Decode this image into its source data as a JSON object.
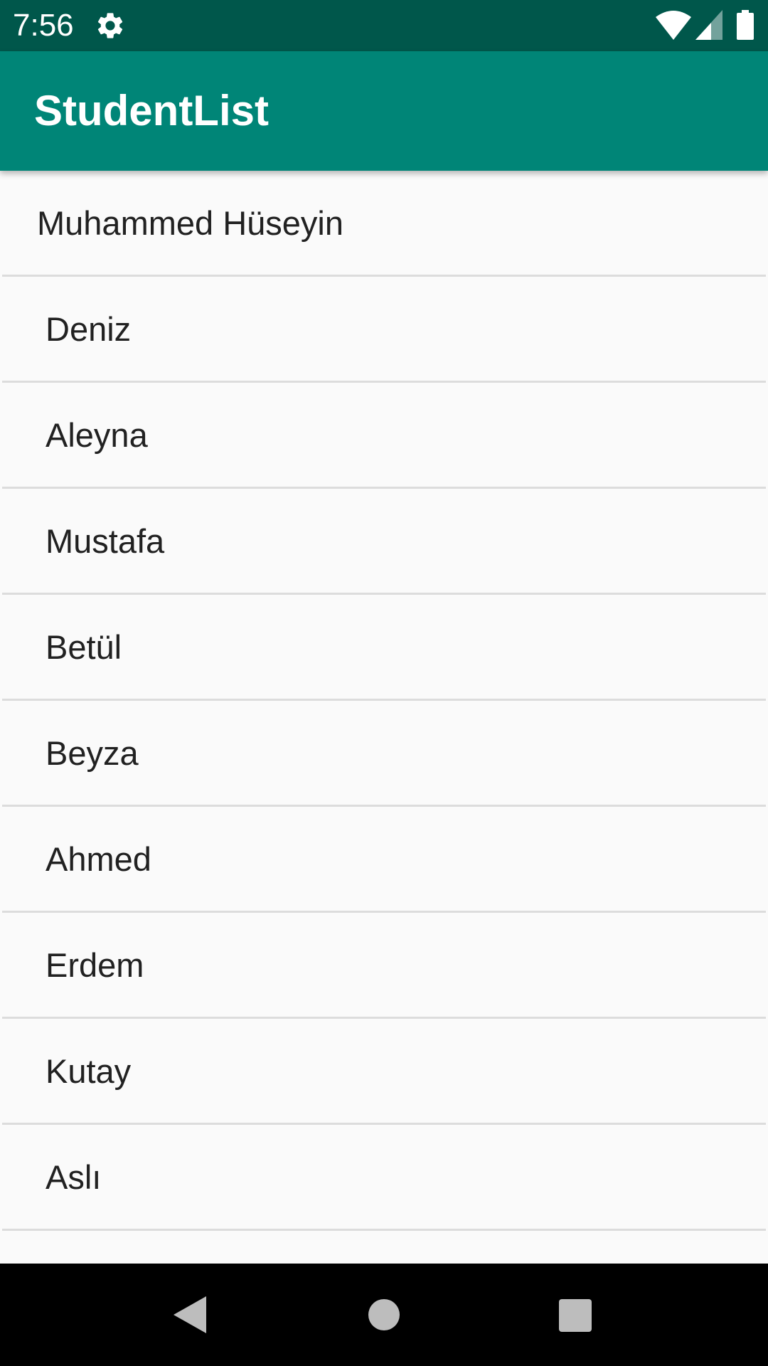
{
  "status_bar": {
    "time": "7:56",
    "icons": [
      "gear-icon",
      "wifi-icon",
      "signal-icon",
      "battery-icon"
    ]
  },
  "app_bar": {
    "title": "StudentList",
    "color": "#008577",
    "status_color": "#00574b"
  },
  "students": [
    "Muhammed Hüseyin",
    "Deniz",
    "Aleyna",
    "Mustafa",
    "Betül",
    "Beyza",
    "Ahmed",
    "Erdem",
    "Kutay",
    "Aslı"
  ],
  "nav_bar": {
    "icons": [
      "back-icon",
      "home-icon",
      "recents-icon"
    ]
  }
}
